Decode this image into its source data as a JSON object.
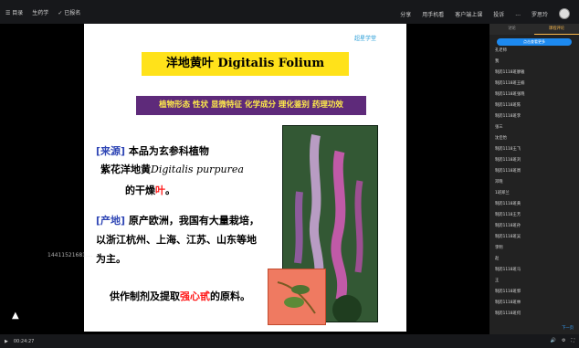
{
  "topbar": {
    "back": "☰ 目录",
    "course": "生药学",
    "reported": "✓ 已报名",
    "share": "分享",
    "phone_watch": "用手机看",
    "client_class": "客户端上课",
    "report": "投诉",
    "more": "...",
    "user": "罗思玲"
  },
  "slide": {
    "logo": "超星学堂",
    "title": "洋地黄叶 Digitalis Folium",
    "topics": "植物形态 性状 显微特征 化学成分 理化鉴别 药理功效",
    "source_label": "[来源]",
    "source_text": "本品为玄参科植物",
    "plant_prefix": "紫花洋地黄",
    "plant_latin": "Digitalis purpurea",
    "dry_prefix": "的干燥",
    "dry_red": "叶",
    "dry_suffix": "。",
    "origin_label": "[产地]",
    "origin_text_1": "原产欧洲，我国有大量栽培，",
    "origin_text_2": "以浙江杭州、上海、江苏、山东等地",
    "origin_text_3": "为主。",
    "use_prefix": "供作制剂及提取",
    "use_red": "强心甙",
    "use_suffix": "的原料。",
    "watermark": "14411521681...."
  },
  "sidebar": {
    "tab_discuss": "讨论",
    "tab_chat": "课程评论",
    "btn": "点击查看更多",
    "items": [
      "孔老师",
      "我",
      "制药1118班廖雅",
      "制药1118班王楠",
      "制药1118班张晓",
      "制药1118班陈",
      "制药1118班李",
      "张三",
      "沈佳怡",
      "制药1118王飞",
      "制药1118班刘",
      "制药1118班周",
      "邓晓",
      "1班郑兰",
      "制药1118班黄",
      "制药1118王芳",
      "制药1118班孙",
      "制药1118班吴",
      "李明",
      "赵",
      "制药1118班马",
      "王",
      "制药1118班郭",
      "制药1118班林",
      "制药1118班何"
    ],
    "next": "下一页"
  },
  "bottombar": {
    "time": "00:24:27"
  }
}
